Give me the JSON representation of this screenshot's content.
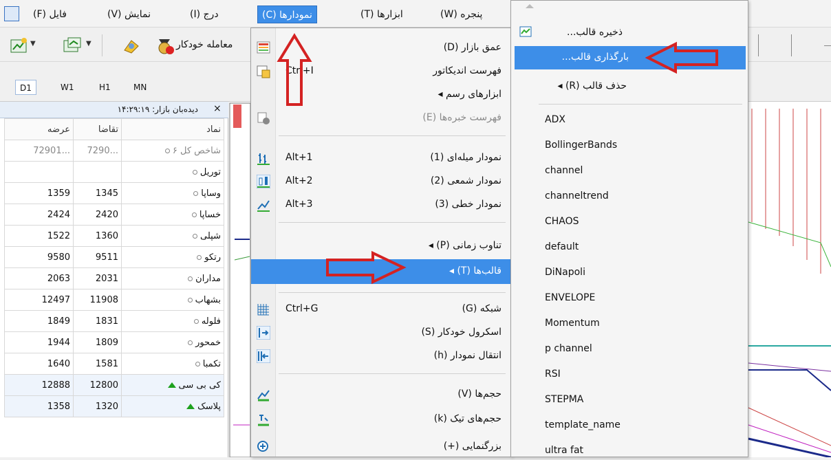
{
  "menubar": {
    "items": [
      "فایل (F)",
      "نمایش (V)",
      "درج (I)",
      "نمودارها (C)",
      "ابزارها (T)",
      "پنجره (W)"
    ]
  },
  "toolbar": {
    "autotrade_label": "معامله خودکار"
  },
  "timeframes": [
    "D1",
    "W1",
    "H1",
    "MN"
  ],
  "market_watch": {
    "title": "دیده‌بان بازار: ۱۴:۲۹:۱۹",
    "columns": [
      "نماد",
      "تقاضا",
      "عرضه"
    ],
    "rows": [
      {
        "symbol": "شاخص کل ۶",
        "bid": "7290...",
        "ask": "72901...",
        "mark": "dot"
      },
      {
        "symbol": "توریل",
        "bid": "",
        "ask": "",
        "mark": "dot"
      },
      {
        "symbol": "وساپا",
        "bid": "1345",
        "ask": "1359",
        "mark": "dot"
      },
      {
        "symbol": "خساپا",
        "bid": "2420",
        "ask": "2424",
        "mark": "dot"
      },
      {
        "symbol": "شپلی",
        "bid": "1360",
        "ask": "1522",
        "mark": "dot"
      },
      {
        "symbol": "رتکو",
        "bid": "9511",
        "ask": "9580",
        "mark": "dot"
      },
      {
        "symbol": "مداران",
        "bid": "2031",
        "ask": "2063",
        "mark": "dot"
      },
      {
        "symbol": "بشهاب",
        "bid": "11908",
        "ask": "12497",
        "mark": "dot"
      },
      {
        "symbol": "فلوله",
        "bid": "1831",
        "ask": "1849",
        "mark": "dot"
      },
      {
        "symbol": "خمحور",
        "bid": "1809",
        "ask": "1944",
        "mark": "dot"
      },
      {
        "symbol": "تکمبا",
        "bid": "1581",
        "ask": "1640",
        "mark": "dot"
      },
      {
        "symbol": "کی بی سی",
        "bid": "12800",
        "ask": "12888",
        "mark": "up"
      },
      {
        "symbol": "پلاسک",
        "bid": "1320",
        "ask": "1358",
        "mark": "up"
      }
    ]
  },
  "charts_menu": {
    "items": [
      {
        "label": "عمق بازار (D)",
        "shortcut": ""
      },
      {
        "label": "فهرست اندیکاتور",
        "shortcut": "Ctrl+I"
      },
      {
        "label": "ابزارهای رسم",
        "shortcut": ""
      },
      {
        "label": "فهرست خبره‌ها (E)",
        "shortcut": ""
      },
      {
        "label": "نمودار میله‌ای (1)",
        "shortcut": "Alt+1"
      },
      {
        "label": "نمودار شمعی (2)",
        "shortcut": "Alt+2"
      },
      {
        "label": "نمودار خطی (3)",
        "shortcut": "Alt+3"
      },
      {
        "label": "تناوب زمانی (P)",
        "shortcut": ""
      },
      {
        "label": "قالب‌ها (T)",
        "shortcut": ""
      },
      {
        "label": "شبکه (G)",
        "shortcut": "Ctrl+G"
      },
      {
        "label": "اسکرول خودکار (S)",
        "shortcut": ""
      },
      {
        "label": "انتقال نمودار (h)",
        "shortcut": ""
      },
      {
        "label": "حجم‌ها (V)",
        "shortcut": ""
      },
      {
        "label": "حجم‌های تیک (k)",
        "shortcut": ""
      },
      {
        "label": "بزرگنمایی (+)",
        "shortcut": ""
      }
    ]
  },
  "templates_menu": {
    "save": "ذخیره قالب...",
    "load": "بارگذاری قالب...",
    "remove": "حذف قالب (R)",
    "templates": [
      "ADX",
      "BollingerBands",
      "channel",
      "channeltrend",
      "CHAOS",
      "default",
      "DiNapoli",
      "ENVELOPE",
      "Momentum",
      "p channel",
      "RSI",
      "STEPMA",
      "template_name",
      "ultra fat"
    ]
  },
  "colors": {
    "highlight": "#3d8ee8",
    "annotation_arrow": "#d42222"
  }
}
